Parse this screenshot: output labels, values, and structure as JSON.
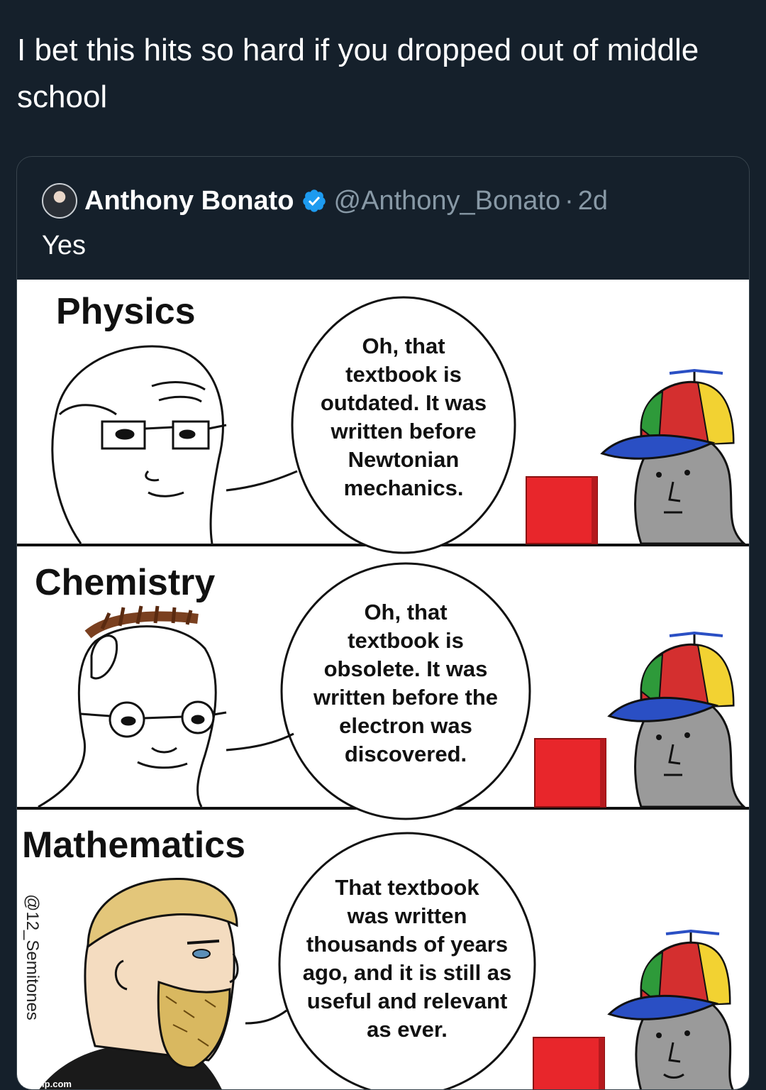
{
  "tweet": {
    "text": "I bet this hits so hard if you dropped out of middle school"
  },
  "quoted_tweet": {
    "author_name": "Anthony Bonato",
    "handle": "@Anthony_Bonato",
    "separator": "·",
    "time": "2d",
    "text": "Yes",
    "verified_icon": "verified-badge-icon",
    "accent_color": "#1d9bf0"
  },
  "comic": {
    "panels": [
      {
        "title": "Physics",
        "speech": [
          "Oh, that",
          "textbook is",
          "outdated. It was",
          "written before",
          "Newtonian",
          "mechanics."
        ]
      },
      {
        "title": "Chemistry",
        "speech": [
          "Oh, that",
          "textbook is",
          "obsolete. It was",
          "written before the",
          "electron was",
          "discovered."
        ]
      },
      {
        "title": "Mathematics",
        "speech": [
          "That textbook",
          "was written",
          "thousands of years",
          "ago, and it is still as",
          "useful and relevant",
          "as ever."
        ]
      }
    ],
    "credit": "@12_Semitones",
    "watermark": "imgflip.com"
  }
}
